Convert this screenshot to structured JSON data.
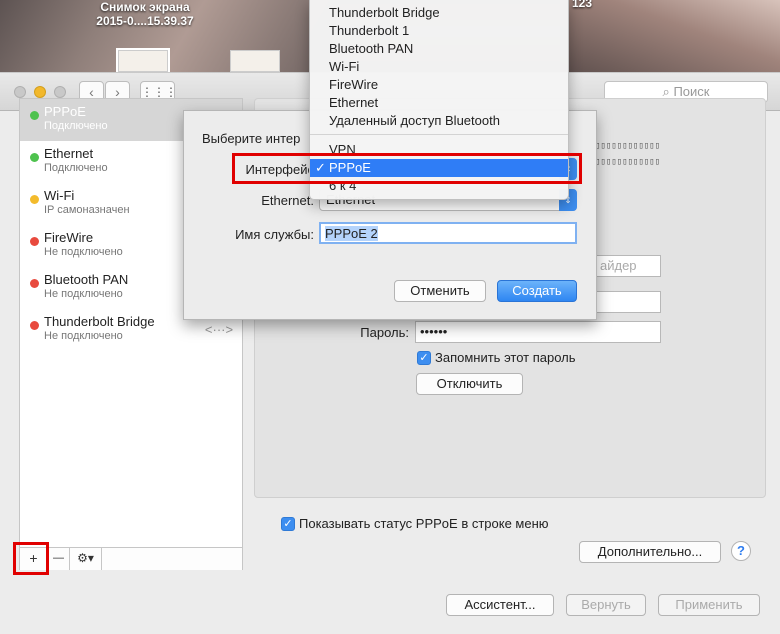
{
  "desktop": {
    "screenshot_label_line1": "Снимок экрана",
    "screenshot_label_line2": "2015-0....15.39.37",
    "top_right_label": "123"
  },
  "toolbar": {
    "search_placeholder": "Поиск",
    "back_glyph": "‹",
    "forward_glyph": "›",
    "grid_glyph": "⋮⋮⋮"
  },
  "services": [
    {
      "name": "PPPoE",
      "status": "Подключено",
      "color": "#4ec24e",
      "selected": true
    },
    {
      "name": "Ethernet",
      "status": "Подключено",
      "color": "#4ec24e"
    },
    {
      "name": "Wi-Fi",
      "status": "IP самоназначен",
      "color": "#f3bb2c"
    },
    {
      "name": "FireWire",
      "status": "Не подключено",
      "color": "#e84a3e"
    },
    {
      "name": "Bluetooth PAN",
      "status": "Не подключено",
      "color": "#e84a3e"
    },
    {
      "name": "Thunderbolt Bridge",
      "status": "Не подключено",
      "color": "#e84a3e"
    }
  ],
  "sidebar_tools": {
    "add": "+",
    "remove": "—",
    "gear": "⚙▾"
  },
  "panel": {
    "provider_suffix": "айдер",
    "password_label": "Пароль:",
    "password_value": "••••••",
    "remember_label": "Запомнить этот пароль",
    "disconnect_button": "Отключить",
    "show_status_label": "Показывать статус PPPoE в строке меню",
    "advanced_button": "Дополнительно...",
    "help": "?",
    "mac_line": "▯▯▯▯▯▯▯▯▯▯▯▯"
  },
  "footer": {
    "assistant": "Ассистент...",
    "revert": "Вернуть",
    "apply": "Применить"
  },
  "sheet": {
    "title": "Выберите интер",
    "interface_label": "Интерфейс",
    "ethernet_label": "Ethernet:",
    "ethernet_value": "Ethernet",
    "service_name_label": "Имя службы:",
    "service_name_value": "PPPoE 2",
    "cancel": "Отменить",
    "create": "Создать"
  },
  "menu": {
    "items_top": [
      "Thunderbolt Bridge",
      "Thunderbolt 1",
      "Bluetooth PAN",
      "Wi-Fi",
      "FireWire",
      "Ethernet",
      "Удаленный доступ Bluetooth"
    ],
    "items_bottom": [
      "VPN",
      "PPPoE",
      "6 к 4"
    ],
    "selected": "PPPoE",
    "check": "✓"
  }
}
